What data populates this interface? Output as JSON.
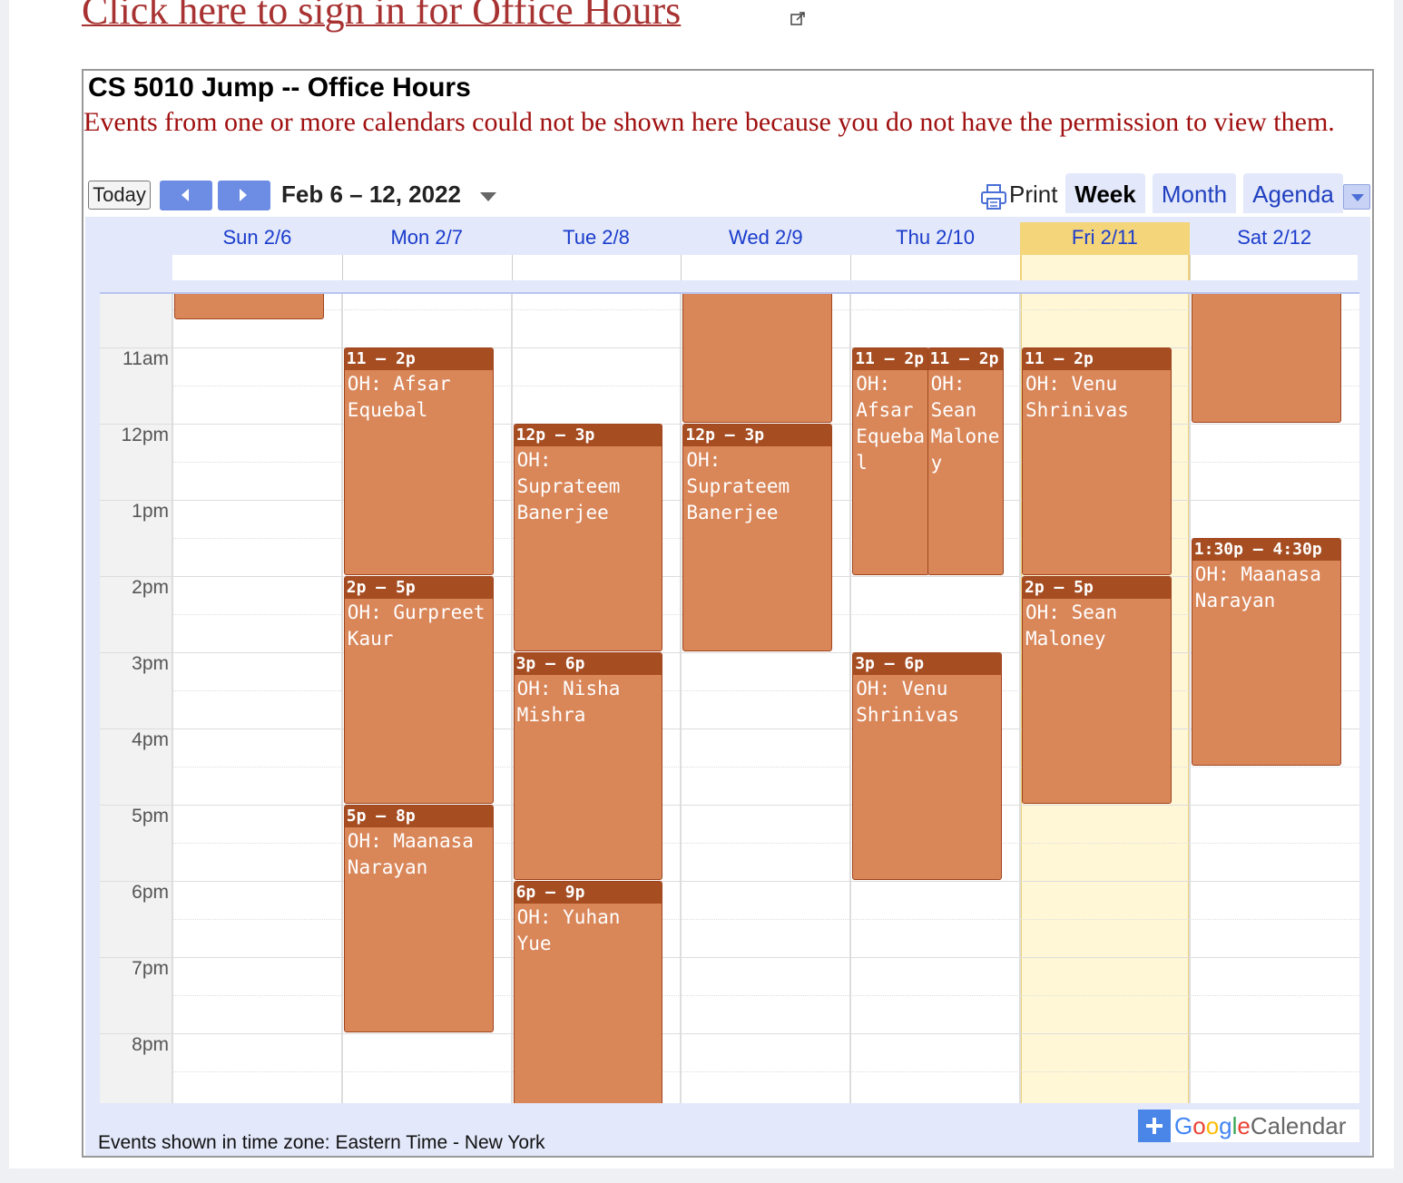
{
  "signin": {
    "link_text": "Click here to sign in for Office Hours"
  },
  "calendar": {
    "title": "CS 5010 Jump -- Office Hours",
    "warning": "Events from one or more calendars could not be shown here because you do not have the permission to view them.",
    "toolbar": {
      "today_label": "Today",
      "date_range": "Feb 6 – 12, 2022",
      "print_label": "Print",
      "tabs": [
        {
          "label": "Week",
          "active": true
        },
        {
          "label": "Month",
          "active": false
        },
        {
          "label": "Agenda",
          "active": false
        }
      ]
    },
    "days": [
      {
        "label": "Sun 2/6",
        "today": false
      },
      {
        "label": "Mon 2/7",
        "today": false
      },
      {
        "label": "Tue 2/8",
        "today": false
      },
      {
        "label": "Wed 2/9",
        "today": false
      },
      {
        "label": "Thu 2/10",
        "today": false
      },
      {
        "label": "Fri 2/11",
        "today": true
      },
      {
        "label": "Sat 2/12",
        "today": false
      }
    ],
    "hours": [
      "11am",
      "12pm",
      "1pm",
      "2pm",
      "3pm",
      "4pm",
      "5pm",
      "6pm",
      "7pm",
      "8pm"
    ],
    "events": [
      {
        "day": 0,
        "start": 10.0,
        "end": 10.65,
        "time": "",
        "title": ""
      },
      {
        "day": 1,
        "start": 11,
        "end": 14,
        "time": "11 – 2p",
        "title": "OH: Afsar Equebal"
      },
      {
        "day": 1,
        "start": 14,
        "end": 17,
        "time": "2p – 5p",
        "title": "OH: Gurpreet Kaur"
      },
      {
        "day": 1,
        "start": 17,
        "end": 20,
        "time": "5p – 8p",
        "title": "OH: Maanasa Narayan"
      },
      {
        "day": 2,
        "start": 12,
        "end": 15,
        "time": "12p – 3p",
        "title": "OH: Suprateem Banerjee"
      },
      {
        "day": 2,
        "start": 15,
        "end": 18,
        "time": "3p – 6p",
        "title": "OH: Nisha Mishra"
      },
      {
        "day": 2,
        "start": 18,
        "end": 21,
        "time": "6p – 9p",
        "title": "OH: Yuhan Yue"
      },
      {
        "day": 3,
        "start": 10.0,
        "end": 12,
        "time": "",
        "title": ""
      },
      {
        "day": 3,
        "start": 12,
        "end": 15,
        "time": "12p – 3p",
        "title": "OH: Suprateem Banerjee"
      },
      {
        "day": 4,
        "start": 11,
        "end": 14,
        "time": "11 – 2p",
        "title": "OH: Afsar Equebal",
        "lane": 0,
        "lanes": 2
      },
      {
        "day": 4,
        "start": 11,
        "end": 14,
        "time": "11 – 2p",
        "title": "OH: Sean Maloney",
        "lane": 1,
        "lanes": 2
      },
      {
        "day": 4,
        "start": 15,
        "end": 18,
        "time": "3p – 6p",
        "title": "OH: Venu Shrinivas"
      },
      {
        "day": 5,
        "start": 11,
        "end": 14,
        "time": "11 – 2p",
        "title": "OH: Venu Shrinivas"
      },
      {
        "day": 5,
        "start": 14,
        "end": 17,
        "time": "2p – 5p",
        "title": "OH: Sean Maloney"
      },
      {
        "day": 6,
        "start": 10.0,
        "end": 12,
        "time": "",
        "title": ""
      },
      {
        "day": 6,
        "start": 13.5,
        "end": 16.5,
        "time": "1:30p – 4:30p",
        "title": "OH: Maanasa Narayan"
      }
    ],
    "footer": {
      "timezone_text": "Events shown in time zone: Eastern Time - New York",
      "badge": {
        "google": "Google",
        "calendar": "Calendar"
      }
    }
  },
  "colors": {
    "event_fill": "#d98659",
    "event_header": "#a64d22",
    "today_highlight": "#fff7d6",
    "link": "#a83232"
  }
}
